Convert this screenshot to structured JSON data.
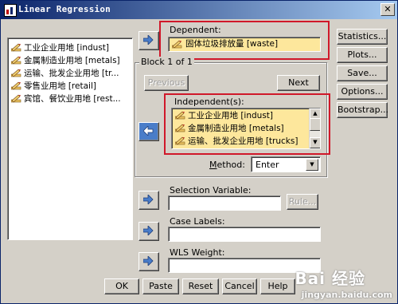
{
  "window": {
    "title": "Linear Regression",
    "close_glyph": "✕"
  },
  "variable_list": [
    {
      "label": "工业企业用地 [indust]"
    },
    {
      "label": "金属制造业用地 [metals]"
    },
    {
      "label": "运输、批发企业用地 [tr..."
    },
    {
      "label": "零售业用地 [retail]"
    },
    {
      "label": "宾馆、餐饮业用地 [rest..."
    }
  ],
  "dependent": {
    "label": "Dependent:",
    "value": "固体垃圾排放量 [waste]"
  },
  "block": {
    "label": "Block 1 of 1",
    "previous": "Previous",
    "next": "Next"
  },
  "independents": {
    "label": "Independent(s):",
    "items": [
      {
        "label": "工业企业用地 [indust]"
      },
      {
        "label": "金属制造业用地 [metals]"
      },
      {
        "label": "运输、批发企业用地 [trucks]"
      }
    ]
  },
  "method": {
    "label": "Method:",
    "value": "Enter"
  },
  "selection_variable": {
    "label": "Selection Variable:",
    "rule_button": "Rule..."
  },
  "case_labels": {
    "label": "Case Labels:"
  },
  "wls_weight": {
    "label": "WLS Weight:"
  },
  "side_buttons": {
    "statistics": "Statistics...",
    "plots": "Plots...",
    "save": "Save...",
    "options": "Options...",
    "bootstrap": "Bootstrap..."
  },
  "bottom_buttons": {
    "ok": "OK",
    "paste": "Paste",
    "reset": "Reset",
    "cancel": "Cancel",
    "help": "Help"
  },
  "watermark": {
    "logo": "Bai 经验",
    "url": "jingyan.baidu.com"
  },
  "colors": {
    "highlight_red": "#d0182a",
    "selected_bg": "#fde79c",
    "title_blue": "#0a246a"
  },
  "icons": {
    "variable": "pencil-ruler-icon",
    "transfer": "right-arrow-icon"
  }
}
